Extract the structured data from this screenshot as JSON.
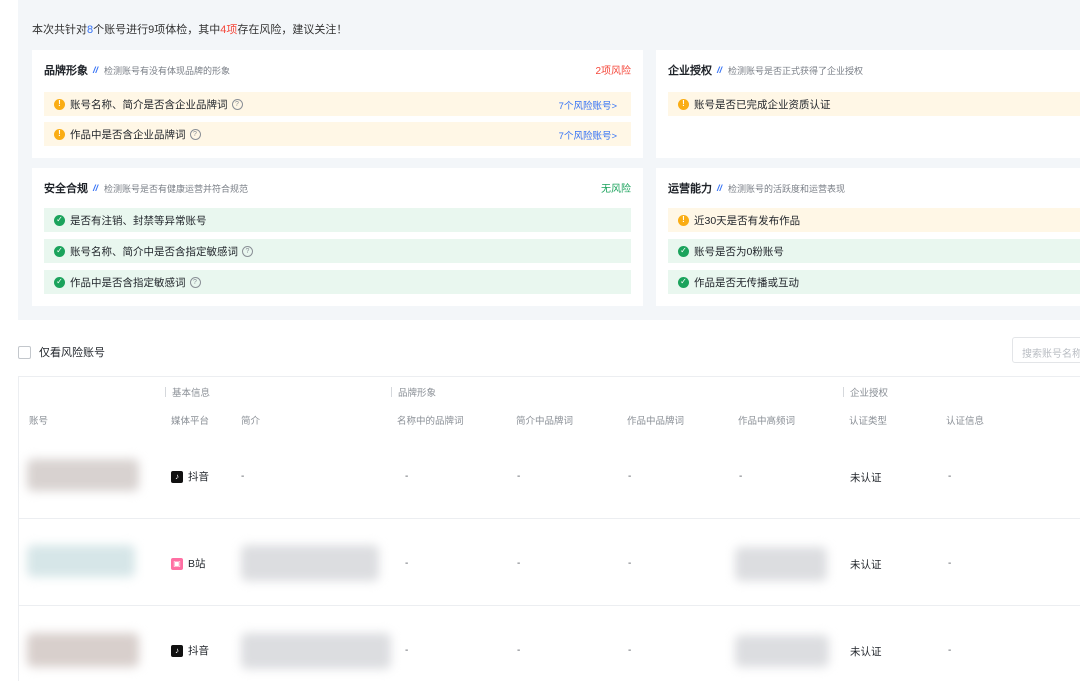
{
  "summary": {
    "prefix": "本次共针对",
    "accounts": "8",
    "mid1": "个账号进行",
    "items": "9",
    "mid2": "项体检，其中",
    "risk_items": "4项",
    "suffix": "存在风险，建议关注！"
  },
  "cards": {
    "brand": {
      "title": "品牌形象",
      "desc": "检测账号有没有体现品牌的形象",
      "status": "2项风险",
      "rows": [
        {
          "label": "账号名称、简介是否含企业品牌词",
          "link": "7个风险账号>"
        },
        {
          "label": "作品中是否含企业品牌词",
          "link": "7个风险账号>"
        }
      ]
    },
    "auth": {
      "title": "企业授权",
      "desc": "检测账号是否正式获得了企业授权",
      "rows": [
        {
          "label": "账号是否已完成企业资质认证"
        }
      ]
    },
    "safety": {
      "title": "安全合规",
      "desc": "检测账号是否有健康运营并符合规范",
      "status": "无风险",
      "rows": [
        {
          "label": "是否有注销、封禁等异常账号"
        },
        {
          "label": "账号名称、简介中是否含指定敏感词"
        },
        {
          "label": "作品中是否含指定敏感词"
        }
      ]
    },
    "ops": {
      "title": "运营能力",
      "desc": "检测账号的活跃度和运营表现",
      "rows": [
        {
          "label": "近30天是否有发布作品"
        },
        {
          "label": "账号是否为0粉账号"
        },
        {
          "label": "作品是否无传播或互动"
        }
      ]
    }
  },
  "filter": {
    "only_risk_label": "仅看风险账号",
    "search_placeholder": "搜索账号名称"
  },
  "table": {
    "groups": {
      "basic": "基本信息",
      "brand": "品牌形象",
      "auth": "企业授权"
    },
    "headers": {
      "account": "账号",
      "platform": "媒体平台",
      "intro": "简介",
      "name_brand": "名称中的品牌词",
      "intro_brand": "简介中品牌词",
      "work_brand": "作品中品牌词",
      "work_freq": "作品中高频词",
      "cert_type": "认证类型",
      "cert_info": "认证信息"
    },
    "rows": [
      {
        "platform": "抖音",
        "intro": "-",
        "name_brand": "-",
        "intro_brand": "-",
        "work_brand": "-",
        "work_freq": "-",
        "cert_type": "未认证",
        "cert_info": "-"
      },
      {
        "platform": "B站",
        "name_brand": "-",
        "intro_brand": "-",
        "work_brand": "-",
        "cert_type": "未认证",
        "cert_info": "-"
      },
      {
        "platform": "抖音",
        "name_brand": "-",
        "intro_brand": "-",
        "work_brand": "-",
        "cert_type": "未认证",
        "cert_info": "-"
      }
    ]
  },
  "colors": {
    "accent": "#3270f5",
    "risk": "#f5483b",
    "ok": "#1ba35c",
    "warn": "#faad14"
  }
}
